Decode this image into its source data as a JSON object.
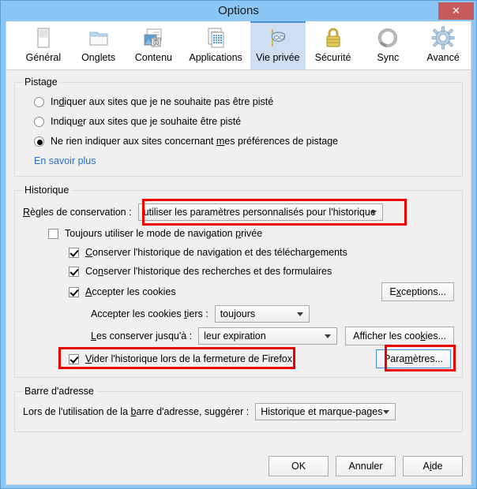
{
  "window": {
    "title": "Options",
    "close_label": "✕"
  },
  "tabs": [
    {
      "label": "Général",
      "icon": "general-icon",
      "selected": false
    },
    {
      "label": "Onglets",
      "icon": "tabs-icon",
      "selected": false
    },
    {
      "label": "Contenu",
      "icon": "content-icon",
      "selected": false
    },
    {
      "label": "Applications",
      "icon": "applications-icon",
      "selected": false
    },
    {
      "label": "Vie privée",
      "icon": "privacy-mask-icon",
      "selected": true
    },
    {
      "label": "Sécurité",
      "icon": "padlock-icon",
      "selected": false
    },
    {
      "label": "Sync",
      "icon": "sync-icon",
      "selected": false
    },
    {
      "label": "Avancé",
      "icon": "gear-icon",
      "selected": false
    }
  ],
  "tracking": {
    "legend": "Pistage",
    "options": [
      {
        "label": "Indiquer aux sites que je ne souhaite pas être pisté",
        "accesskey": "d",
        "checked": false
      },
      {
        "label": "Indiquer aux sites que je souhaite être pisté",
        "accesskey": "e",
        "checked": false
      },
      {
        "label": "Ne rien indiquer aux sites concernant mes préférences de pistage",
        "accesskey": "m",
        "checked": true
      }
    ],
    "learn_more": "En savoir plus"
  },
  "history": {
    "legend": "Historique",
    "rules_label": "Règles de conservation :",
    "rules_accesskey": "R",
    "rules_value": "utiliser les paramètres personnalisés pour l'historique",
    "always_private_label": "Toujours utiliser le mode de navigation privée",
    "always_private_accesskey": "p",
    "always_private_checked": false,
    "keep_browsing_label": "Conserver l'historique de navigation et des téléchargements",
    "keep_browsing_accesskey": "C",
    "keep_browsing_checked": true,
    "keep_search_label": "Conserver l'historique des recherches et des formulaires",
    "keep_search_accesskey": "n",
    "keep_search_checked": true,
    "accept_cookies_label": "Accepter les cookies",
    "accept_cookies_accesskey": "A",
    "accept_cookies_checked": true,
    "exceptions_button": "Exceptions...",
    "exceptions_accesskey": "x",
    "third_party_label": "Accepter les cookies tiers :",
    "third_party_accesskey": "t",
    "third_party_value": "toujours",
    "keep_until_label": "Les conserver jusqu'à :",
    "keep_until_accesskey": "L",
    "keep_until_value": "leur expiration",
    "show_cookies_button": "Afficher les cookies...",
    "show_cookies_accesskey": "k",
    "clear_on_close_label": "Vider l'historique lors de la fermeture de Firefox",
    "clear_on_close_accesskey": "V",
    "clear_on_close_checked": true,
    "settings_button": "Paramètres...",
    "settings_accesskey": "m"
  },
  "address_bar": {
    "legend": "Barre d'adresse",
    "suggest_label": "Lors de l'utilisation de la barre d'adresse, suggérer :",
    "suggest_accesskey": "b",
    "suggest_value": "Historique et marque-pages"
  },
  "footer": {
    "ok": "OK",
    "cancel": "Annuler",
    "help": "Aide",
    "help_accesskey": "i"
  },
  "colors": {
    "titlebar": "#8cc6f5",
    "close_button": "#c75b5b",
    "selected_tab_bg": "#cfdff2",
    "selected_tab_border": "#4a90d9",
    "link": "#2a6fc9",
    "annotation": "#ee0000",
    "dialog_bg": "#f0f0f0"
  }
}
